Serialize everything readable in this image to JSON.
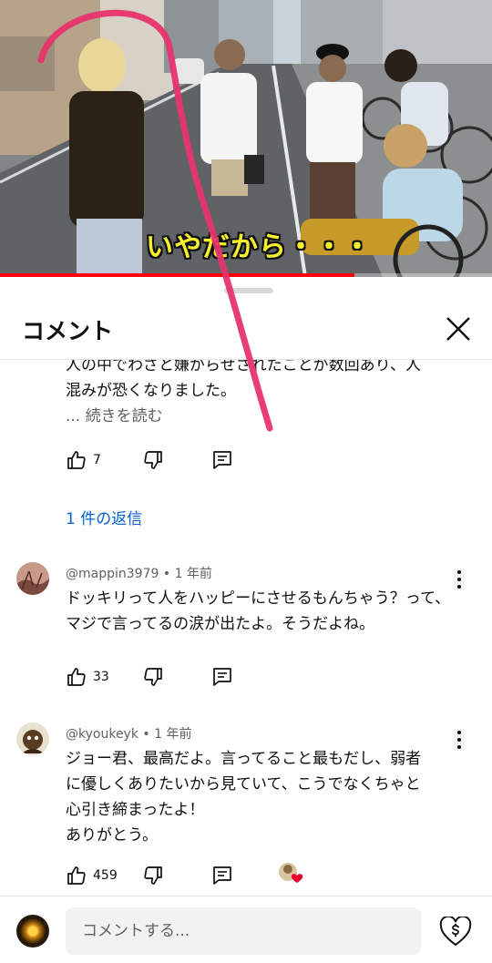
{
  "video": {
    "caption": "いやだから・・・",
    "progress": 0.72
  },
  "sheet": {
    "title": "コメント"
  },
  "partial_comment": {
    "text_line1": "人の中でわざと嫌がらせされたことが数回あり、人",
    "text_line2": "混みが恐くなりました。",
    "read_more": "... 続きを読む",
    "likes": "7",
    "replies_link": "1 件の返信"
  },
  "comments": [
    {
      "author": "@mappin3979",
      "time": "1 年前",
      "text": "ドッキリって人をハッピーにさせるもんちゃう？って、マジで言ってるの涙が出たよ。そうだよね。",
      "likes": "33"
    },
    {
      "author": "@kyoukeyk",
      "time": "1 年前",
      "text_lines": [
        "ジョー君、最高だよ。言ってること最もだし、弱者",
        "に優しくありたいから見ていて、こうでなくちゃと",
        "心引き締まったよ！",
        "ありがとう。"
      ],
      "likes": "459"
    }
  ],
  "composer": {
    "placeholder": "コメントする..."
  },
  "colors": {
    "accent_link": "#065fd4",
    "progress": "#ff0000",
    "caption": "#f6ef2c",
    "scribble": "#e8336e"
  }
}
